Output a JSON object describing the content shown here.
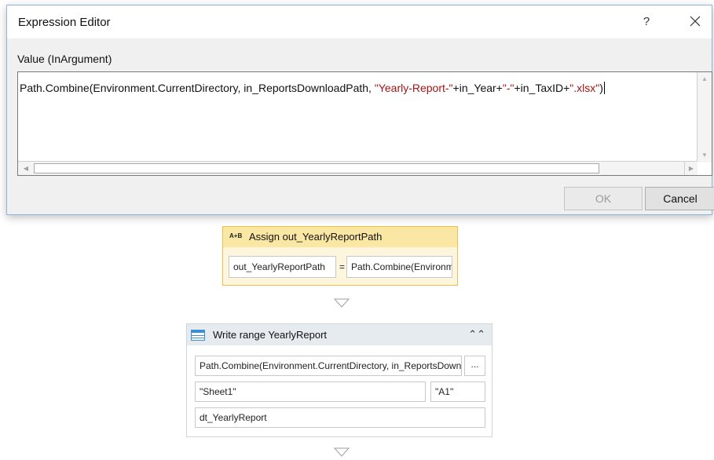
{
  "dialog": {
    "title": "Expression Editor",
    "help": "?",
    "value_label": "Value (InArgument)",
    "code": {
      "p1": "Path.Combine(Environment.CurrentDirectory, in_ReportsDownloadPath, ",
      "s1": "\"Yearly-Report-\"",
      "p2": "+in_Year+",
      "s2": "\"-\"",
      "p3": "+in_TaxID+",
      "s3": "\".xlsx\"",
      "p4": ")"
    },
    "ok_label": "OK",
    "cancel_label": "Cancel"
  },
  "assign": {
    "icon_text": "A+B",
    "title": "Assign out_YearlyReportPath",
    "to_value": "out_YearlyReportPath",
    "eq": "=",
    "value": "Path.Combine(Environment.CurrentDirectory"
  },
  "write_range": {
    "title": "Write range YearlyReport",
    "path_value": "Path.Combine(Environment.CurrentDirectory, in_ReportsDownloadPath",
    "ellipsis": "...",
    "sheet_value": "\"Sheet1\"",
    "cell_value": "\"A1\"",
    "datatable_value": "dt_YearlyReport"
  },
  "colors": {
    "string_literal": "#a31515",
    "assign_border": "#f0c048",
    "assign_header": "#fbe7a4",
    "write_header": "#e6ebf0"
  },
  "icons": {
    "close": "close-icon",
    "collapse": "double-chevron-up-icon",
    "write_range": "table-icon",
    "connector": "triangle-down-icon"
  }
}
